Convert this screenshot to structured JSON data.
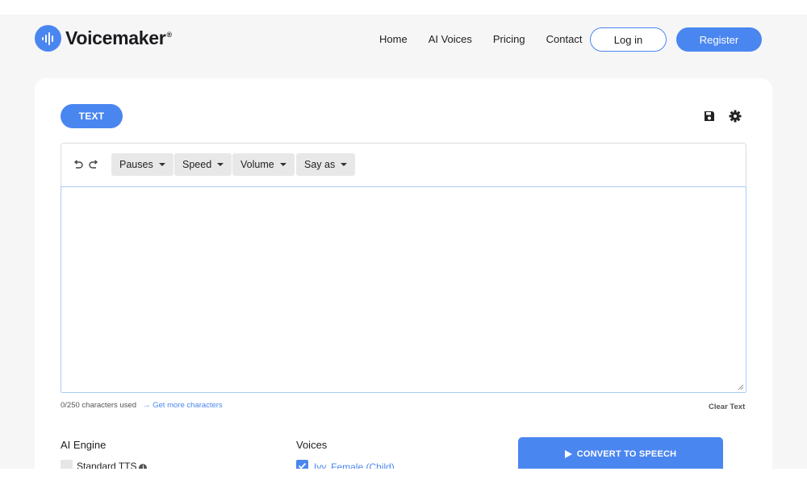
{
  "brand": {
    "name": "Voicemaker",
    "reg_mark": "®"
  },
  "nav": {
    "links": [
      "Home",
      "AI Voices",
      "Pricing",
      "Contact"
    ],
    "login_label": "Log in",
    "register_label": "Register"
  },
  "editor": {
    "mode_tab": "TEXT",
    "toolbar": {
      "pauses": "Pauses",
      "speed": "Speed",
      "volume": "Volume",
      "say_as": "Say as"
    },
    "text_value": "",
    "char_count": "0/250 characters used",
    "more_chars_link": "→ Get more characters",
    "clear_text": "Clear Text"
  },
  "options": {
    "engine_label": "AI Engine",
    "engine_option": "Standard TTS",
    "voices_label": "Voices",
    "voice_option": "Ivy, Female (Child)"
  },
  "convert_label": "CONVERT TO SPEECH",
  "colors": {
    "accent": "#4a86f0",
    "page_bg": "#f6f6f7"
  }
}
